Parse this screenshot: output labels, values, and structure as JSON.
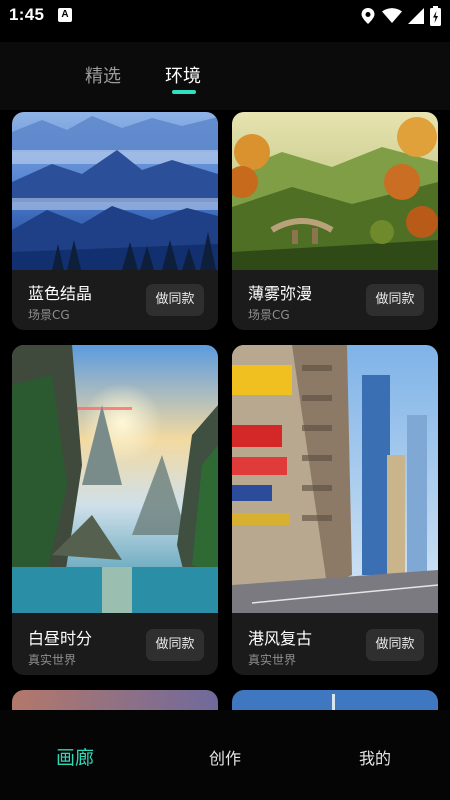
{
  "status": {
    "time": "1:45",
    "badge": "A"
  },
  "tabs": [
    {
      "label": "精选",
      "active": false
    },
    {
      "label": "环境",
      "active": true
    }
  ],
  "accent_color": "#30d8b8",
  "cards": [
    {
      "title": "蓝色结晶",
      "subtitle": "场景CG",
      "button": "做同款",
      "image": "blue-mountain-landscape"
    },
    {
      "title": "薄雾弥漫",
      "subtitle": "场景CG",
      "button": "做同款",
      "image": "autumn-valley-bridge"
    },
    {
      "title": "白昼时分",
      "subtitle": "真实世界",
      "button": "做同款",
      "image": "karst-cliffs-river"
    },
    {
      "title": "港风复古",
      "subtitle": "真实世界",
      "button": "做同款",
      "image": "hong-kong-street"
    }
  ],
  "bottom_nav": [
    {
      "label": "画廊",
      "active": true
    },
    {
      "label": "创作",
      "active": false
    },
    {
      "label": "我的",
      "active": false
    }
  ]
}
